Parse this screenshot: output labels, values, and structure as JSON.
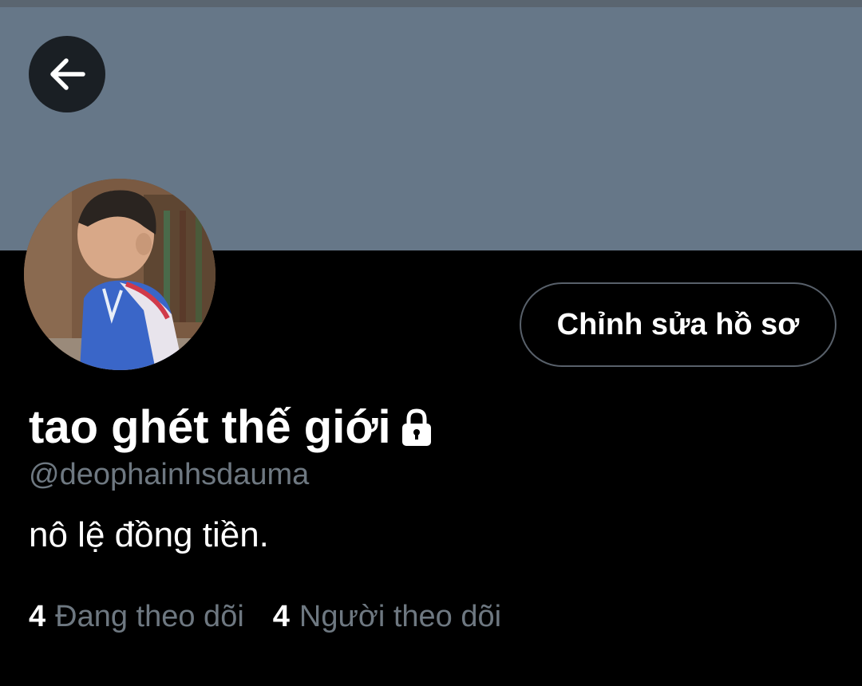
{
  "colors": {
    "background": "#000000",
    "banner": "#667788",
    "secondary_text": "#6e7881",
    "button_border": "#58606a"
  },
  "header": {
    "back_icon": "arrow-left-icon"
  },
  "profile": {
    "display_name": "tao ghét thế giới",
    "protected_icon": "lock-icon",
    "username": "@deophainhsdauma",
    "bio": "nô lệ đồng tiền.",
    "edit_button_label": "Chỉnh sửa hồ sơ"
  },
  "stats": {
    "following_count": "4",
    "following_label": "Đang theo dõi",
    "followers_count": "4",
    "followers_label": "Người theo dõi"
  }
}
